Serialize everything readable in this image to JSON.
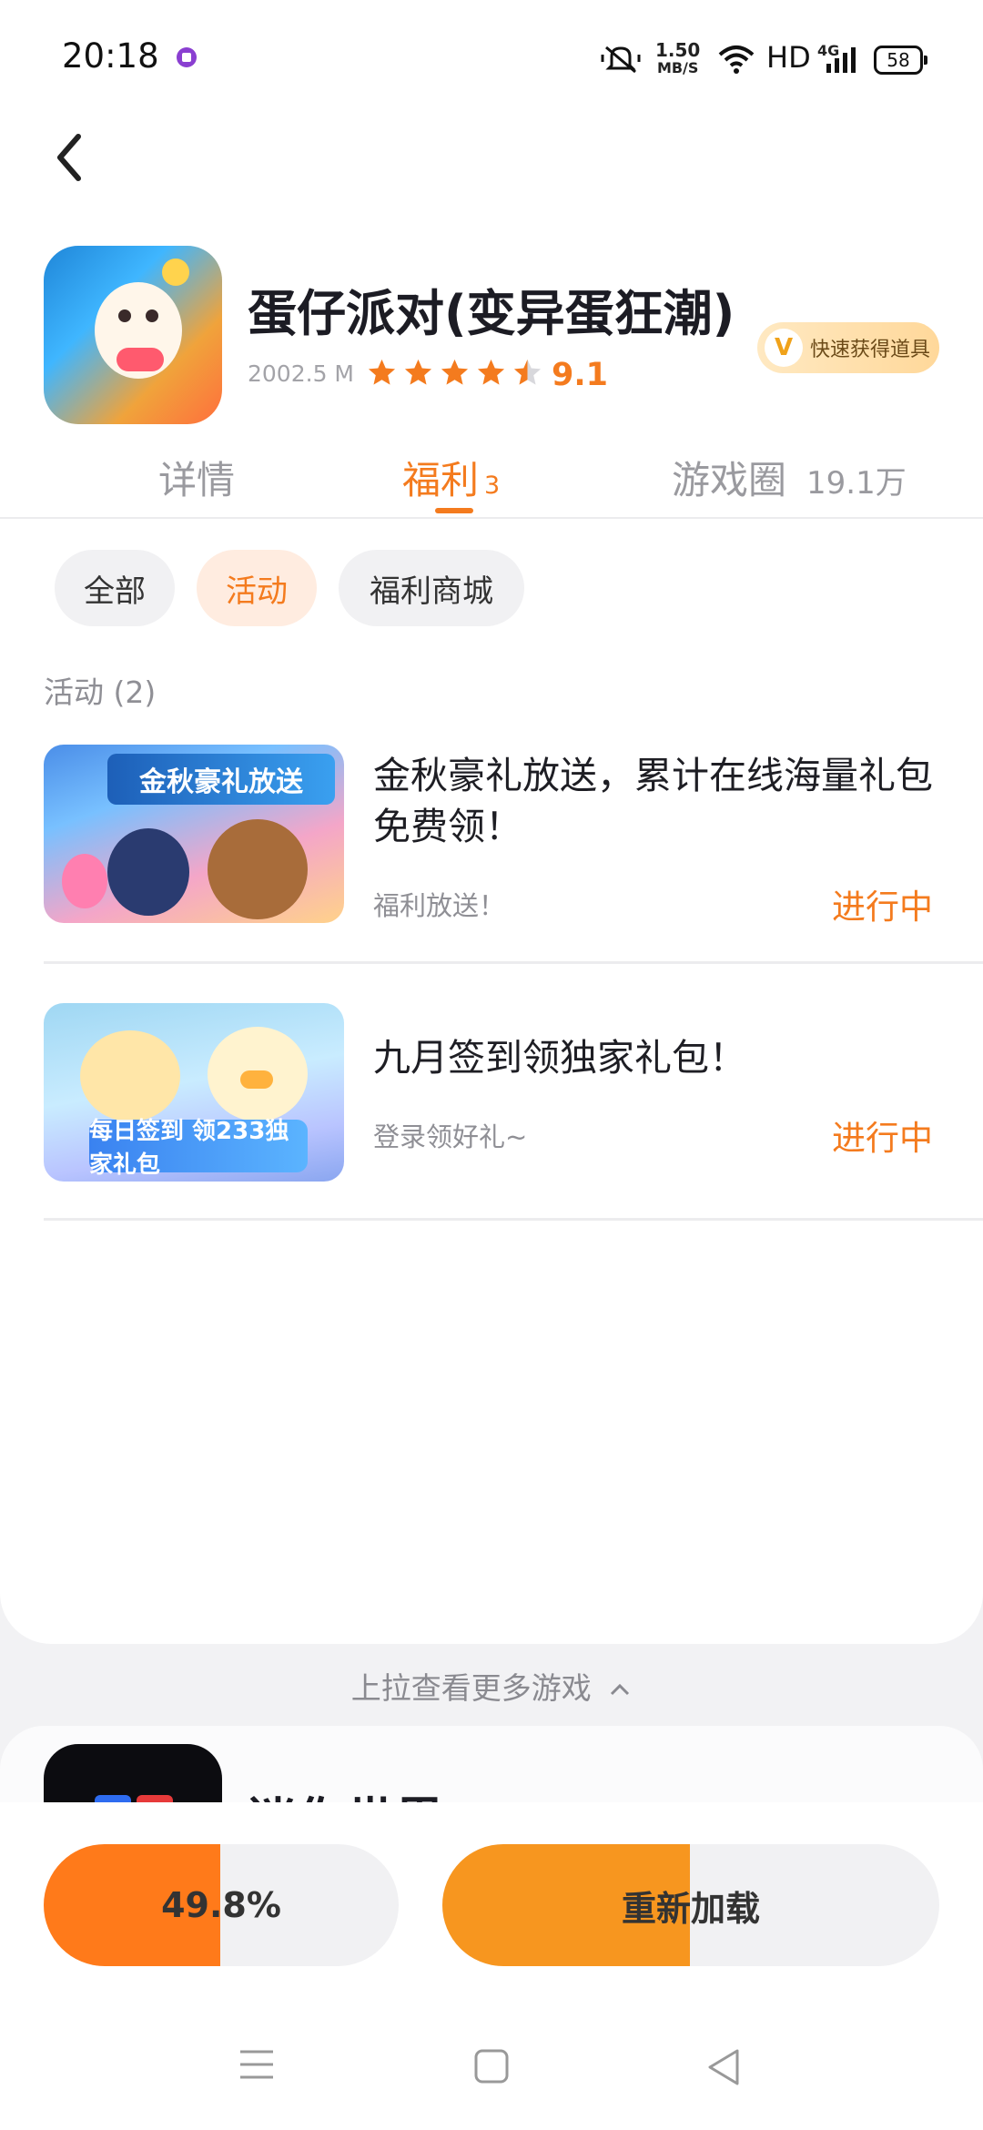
{
  "status_bar": {
    "time": "20:18",
    "network_speed_value": "1.50",
    "network_speed_unit": "MB/S",
    "hd_label": "HD",
    "signal_label": "4G",
    "battery": "58"
  },
  "game": {
    "title": "蛋仔派对(变异蛋狂潮)",
    "size": "2002.5 M",
    "rating": "9.1",
    "rating_stars": 4.5,
    "badge_label": "快速获得道具"
  },
  "tabs": [
    {
      "label": "详情"
    },
    {
      "label": "福利",
      "count": "3"
    },
    {
      "label": "游戏圈",
      "count": "19.1万"
    }
  ],
  "filters": [
    {
      "label": "全部"
    },
    {
      "label": "活动"
    },
    {
      "label": "福利商城"
    }
  ],
  "section": {
    "label": "活动 (2)"
  },
  "activities": [
    {
      "title": "金秋豪礼放送，累计在线海量礼包免费领！",
      "subtitle": "福利放送！",
      "status": "进行中",
      "banner_text": "金秋豪礼放送"
    },
    {
      "title": "九月签到领独家礼包！",
      "subtitle": "登录领好礼~",
      "status": "进行中",
      "banner_text": "每日签到 领233独家礼包"
    }
  ],
  "pull_hint": "上拉查看更多游戏",
  "next_game": {
    "title": "迷你世界"
  },
  "actions": {
    "progress_label": "49.8%",
    "progress_value": 0.498,
    "reload_label": "重新加载"
  },
  "colors": {
    "accent": "#f47b1e",
    "accent_light": "#ffece0",
    "progress_fill": "#ff7a1a"
  }
}
